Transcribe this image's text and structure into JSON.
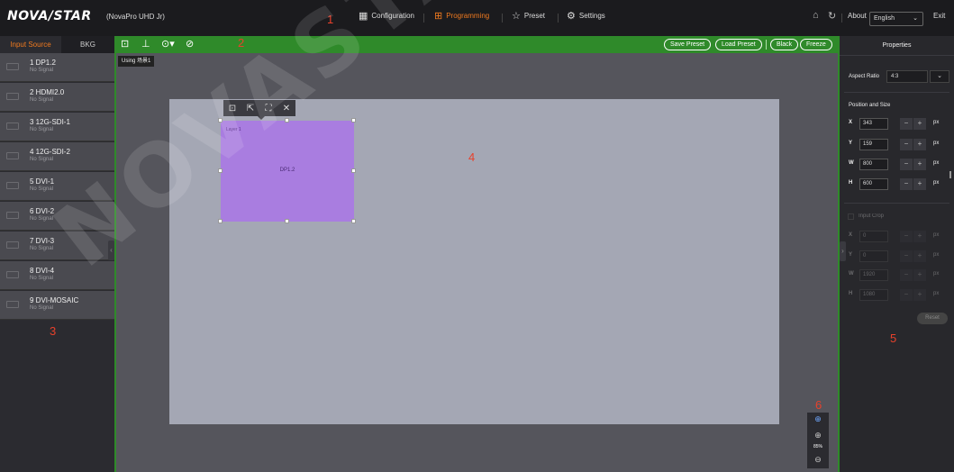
{
  "header": {
    "logo_text": "NOVA/STAR",
    "model": "(NovaPro UHD Jr)",
    "nav": [
      {
        "label": "Configuration",
        "icon": "grid-icon",
        "active": false
      },
      {
        "label": "Programming",
        "icon": "layout-icon",
        "active": true
      },
      {
        "label": "Preset",
        "icon": "star-icon",
        "active": false
      },
      {
        "label": "Settings",
        "icon": "gear-icon",
        "active": false
      }
    ],
    "about": "About",
    "language": "English",
    "exit": "Exit"
  },
  "callouts": [
    "1",
    "2",
    "3",
    "4",
    "5",
    "6"
  ],
  "left_panel": {
    "tabs": [
      "Input Source",
      "BKG"
    ],
    "sources": [
      {
        "name": "1 DP1.2",
        "status": "No Signal"
      },
      {
        "name": "2 HDMI2.0",
        "status": "No Signal"
      },
      {
        "name": "3 12G-SDI-1",
        "status": "No Signal"
      },
      {
        "name": "4 12G-SDI-2",
        "status": "No Signal"
      },
      {
        "name": "5 DVI-1",
        "status": "No Signal"
      },
      {
        "name": "6 DVI-2",
        "status": "No Signal"
      },
      {
        "name": "7 DVI-3",
        "status": "No Signal"
      },
      {
        "name": "8 DVI-4",
        "status": "No Signal"
      },
      {
        "name": "9 DVI-MOSAIC",
        "status": "No Signal"
      }
    ]
  },
  "toolbar": {
    "save_preset": "Save Preset",
    "load_preset": "Load Preset",
    "black": "Black",
    "freeze": "Freeze"
  },
  "workspace": {
    "using_label": "Using 场景1",
    "layer_name": "Layer 1",
    "layer_source": "DP1.2",
    "zoom": "85%"
  },
  "properties": {
    "title": "Properties",
    "aspect_ratio_label": "Aspect Ratio",
    "aspect_ratio_value": "4:3",
    "position_size_label": "Position and Size",
    "fields": [
      {
        "label": "X",
        "value": "343",
        "unit": "px"
      },
      {
        "label": "Y",
        "value": "159",
        "unit": "px"
      },
      {
        "label": "W",
        "value": "800",
        "unit": "px"
      },
      {
        "label": "H",
        "value": "600",
        "unit": "px"
      }
    ],
    "input_crop_label": "Input Crop",
    "crop_fields": [
      {
        "label": "X",
        "value": "0",
        "unit": "px"
      },
      {
        "label": "Y",
        "value": "0",
        "unit": "px"
      },
      {
        "label": "W",
        "value": "1920",
        "unit": "px"
      },
      {
        "label": "H",
        "value": "1080",
        "unit": "px"
      }
    ],
    "reset": "Reset"
  },
  "watermark": "NOVASTAR",
  "colors": {
    "accent_orange": "#f07a1f",
    "toolbar_green": "#2f8a2a",
    "layer_purple": "#a97de0",
    "callout_red": "#e8412b"
  }
}
